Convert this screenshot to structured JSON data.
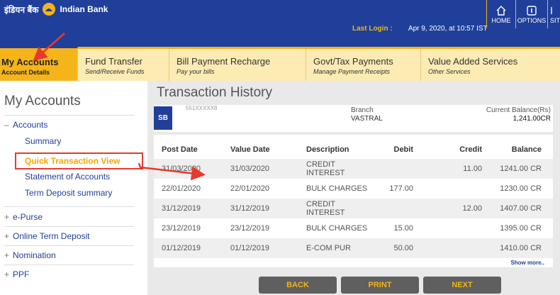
{
  "header": {
    "logo_hindi": "इंडियन बैंक",
    "logo_text": "Indian Bank",
    "last_login_label": "Last Login :",
    "last_login_value": "Apr 9, 2020, at 10:57 IST",
    "icons": [
      {
        "label": "HOME",
        "icon": "home-icon"
      },
      {
        "label": "OPTIONS",
        "icon": "options-icon"
      },
      {
        "label": "SITE",
        "icon": "sitemap-icon"
      }
    ]
  },
  "tabs": [
    {
      "title": "My Accounts",
      "subtitle": "Account Details"
    },
    {
      "title": "Fund Transfer",
      "subtitle": "Send/Receive Funds"
    },
    {
      "title": "Bill Payment Recharge",
      "subtitle": "Pay your bills"
    },
    {
      "title": "Govt/Tax Payments",
      "subtitle": "Manage Payment Receipts"
    },
    {
      "title": "Value Added Services",
      "subtitle": "Other Services"
    }
  ],
  "sidebar": {
    "title": "My Accounts",
    "accounts_label": "Accounts",
    "accounts_sign": "–",
    "subitems": [
      "Summary",
      "Quick Transaction View",
      "Statement of Accounts",
      "Term Deposit summary"
    ],
    "groups": [
      "e-Purse",
      "Online Term Deposit",
      "Nomination",
      "PPF"
    ],
    "group_sign": "+"
  },
  "main": {
    "title": "Transaction History",
    "account_type": "SB",
    "account_number": "551XXXXX8",
    "branch_label": "Branch",
    "branch_value": "VASTRAL",
    "balance_label": "Current Balance(Rs)",
    "balance_value": "1,241.00CR",
    "columns": [
      "Post Date",
      "Value Date",
      "Description",
      "Debit",
      "Credit",
      "Balance"
    ],
    "rows": [
      [
        "31/03/2020",
        "31/03/2020",
        "CREDIT INTEREST",
        "",
        "11.00",
        "1241.00 CR"
      ],
      [
        "22/01/2020",
        "22/01/2020",
        "BULK CHARGES",
        "177.00",
        "",
        "1230.00 CR"
      ],
      [
        "31/12/2019",
        "31/12/2019",
        "CREDIT INTEREST",
        "",
        "12.00",
        "1407.00 CR"
      ],
      [
        "23/12/2019",
        "23/12/2019",
        "BULK CHARGES",
        "15.00",
        "",
        "1395.00 CR"
      ],
      [
        "01/12/2019",
        "01/12/2019",
        "E-COM PUR",
        "50.00",
        "",
        "1410.00 CR"
      ]
    ],
    "show_more": "Show more..",
    "buttons": {
      "back": "BACK",
      "print": "PRINT",
      "next": "NEXT"
    }
  },
  "colors": {
    "brand_blue": "#1f3f9a",
    "brand_yellow": "#f4b41a",
    "annotation_red": "#e53a2e"
  }
}
